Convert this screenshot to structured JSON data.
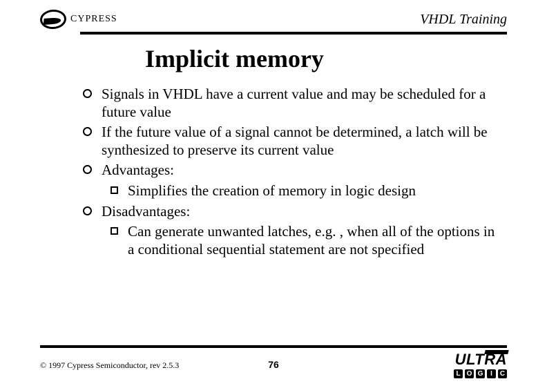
{
  "header": {
    "brand": "CYPRESS",
    "title": "VHDL Training"
  },
  "slide": {
    "title": "Implicit memory",
    "bullets": [
      {
        "text": "Signals in VHDL have a current value and may be scheduled for a future value"
      },
      {
        "text": "If the future value of a signal cannot be determined, a latch will be synthesized to preserve its current value"
      },
      {
        "text": "Advantages:",
        "sub": [
          {
            "text": "Simplifies the creation of memory in logic design"
          }
        ]
      },
      {
        "text": "Disadvantages:",
        "sub": [
          {
            "text": "Can generate unwanted latches, e.g. , when all of the options in a conditional sequential statement are not specified"
          }
        ]
      }
    ]
  },
  "footer": {
    "copyright": "© 1997 Cypress Semiconductor, rev 2.5.3",
    "page": "76",
    "ultra": "ULTRA",
    "logic": [
      "L",
      "O",
      "G",
      "I",
      "C"
    ]
  }
}
